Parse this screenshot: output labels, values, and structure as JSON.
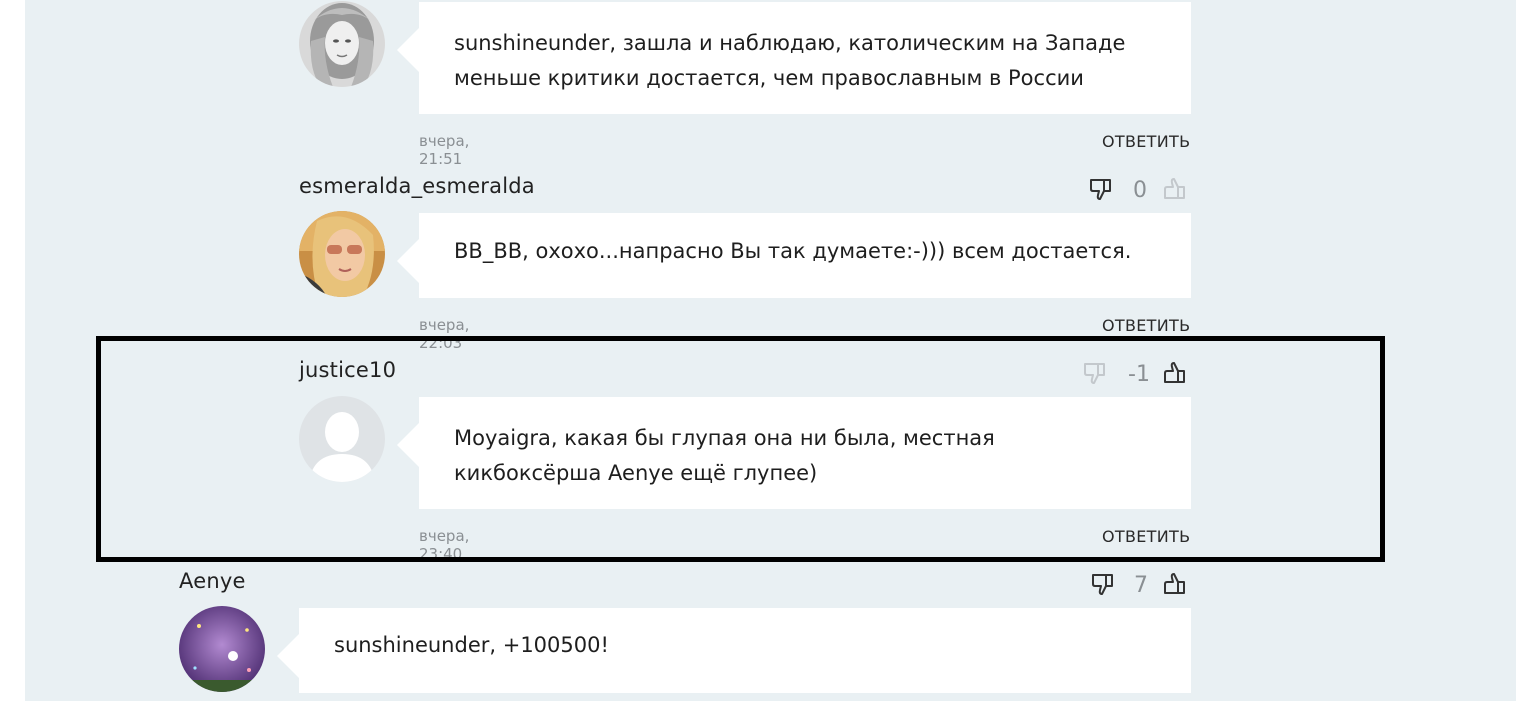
{
  "comments": [
    {
      "text": "sunshineunder, зашла и наблюдаю, католическим на Западе меньше критики достается, чем православным в России",
      "timestamp": "вчера, 21:51",
      "reply_label": "ОТВЕТИТЬ",
      "avatar": "avatar-blonde-woman-bw"
    },
    {
      "username": "esmeralda_esmeralda",
      "vote_count": "0",
      "text": "BB_BB, охохо...напрасно Вы так думаете:-))) всем достается.",
      "timestamp": "вчера, 22:03",
      "reply_label": "ОТВЕТИТЬ",
      "avatar": "avatar-woman-sunglasses"
    },
    {
      "username": "justice10",
      "vote_count": "-1",
      "text": "Moyaigra, какая бы глупая она ни была, местная кикбоксёрша Aenye ещё глупее)",
      "timestamp": "вчера, 23:40",
      "reply_label": "ОТВЕТИТЬ",
      "avatar": "avatar-default-silhouette"
    },
    {
      "username": "Aenye",
      "vote_count": "7",
      "text": "sunshineunder, +100500!",
      "avatar": "avatar-moon-illustration"
    }
  ],
  "colors": {
    "page_background": "#e9f0f3",
    "bubble": "#ffffff",
    "meta_text": "#8a8f93",
    "highlight_border": "#000000"
  },
  "icons": {
    "dislike": "thumbs-down-icon",
    "like": "thumbs-up-icon"
  }
}
